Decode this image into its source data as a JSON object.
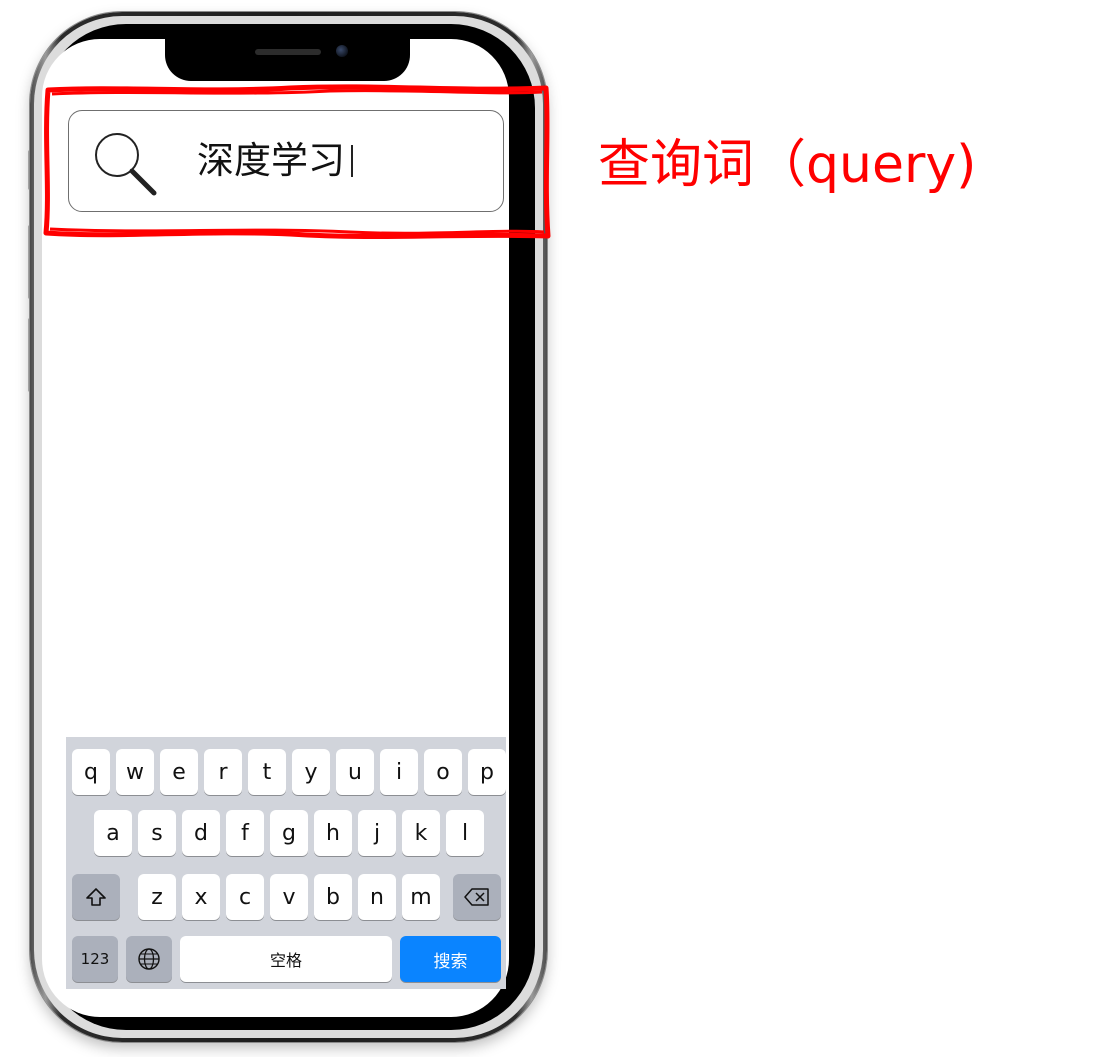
{
  "search": {
    "query": "深度学习",
    "icon": "search-icon"
  },
  "annotation": {
    "label": "查询词（query)",
    "color": "#ff0000"
  },
  "keyboard": {
    "row1": [
      "q",
      "w",
      "e",
      "r",
      "t",
      "y",
      "u",
      "i",
      "o",
      "p"
    ],
    "row2": [
      "a",
      "s",
      "d",
      "f",
      "g",
      "h",
      "j",
      "k",
      "l"
    ],
    "row3": [
      "z",
      "x",
      "c",
      "v",
      "b",
      "n",
      "m"
    ],
    "shift_icon": "shift-icon",
    "delete_icon": "backspace-icon",
    "numbers_label": "123",
    "globe_icon": "globe-icon",
    "space_label": "空格",
    "search_label": "搜索",
    "accent_color": "#0a84ff"
  }
}
